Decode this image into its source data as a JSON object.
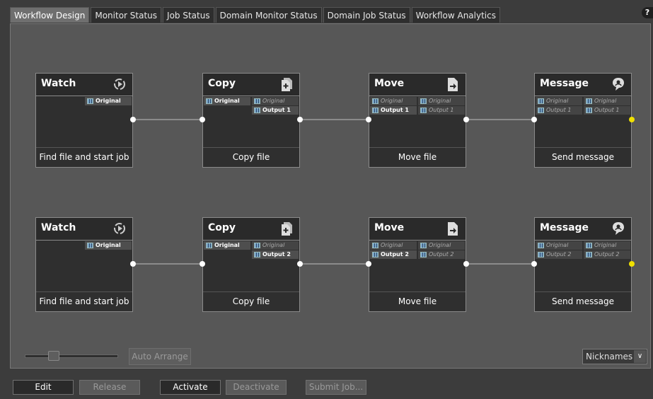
{
  "tabs": [
    {
      "label": "Workflow Design",
      "active": true
    },
    {
      "label": "Monitor Status"
    },
    {
      "label": "Job Status"
    },
    {
      "label": "Domain Monitor Status"
    },
    {
      "label": "Domain Job Status"
    },
    {
      "label": "Workflow Analytics"
    }
  ],
  "help_label": "?",
  "workflow_rows": [
    {
      "nodes": [
        {
          "title": "Watch",
          "icon": "watch-icon",
          "footer": "Find file and start job",
          "chips_left": [],
          "chips_right": [
            {
              "label": "Original",
              "dim": false
            }
          ]
        },
        {
          "title": "Copy",
          "icon": "copy-icon",
          "footer": "Copy file",
          "chips_left": [
            {
              "label": "Original",
              "dim": false
            }
          ],
          "chips_right": [
            {
              "label": "Original",
              "dim": true
            },
            {
              "label": "Output 1",
              "dim": false
            }
          ]
        },
        {
          "title": "Move",
          "icon": "move-icon",
          "footer": "Move file",
          "chips_left": [
            {
              "label": "Original",
              "dim": true
            },
            {
              "label": "Output 1",
              "dim": false
            }
          ],
          "chips_right": [
            {
              "label": "Original",
              "dim": true
            },
            {
              "label": "Output 1",
              "dim": true
            }
          ]
        },
        {
          "title": "Message",
          "icon": "message-icon",
          "footer": "Send message",
          "chips_left": [
            {
              "label": "Original",
              "dim": true
            },
            {
              "label": "Output 1",
              "dim": true
            }
          ],
          "chips_right": [
            {
              "label": "Original",
              "dim": true
            },
            {
              "label": "Output 1",
              "dim": true
            }
          ]
        }
      ]
    },
    {
      "nodes": [
        {
          "title": "Watch",
          "icon": "watch-icon",
          "footer": "Find file and start job",
          "chips_left": [],
          "chips_right": [
            {
              "label": "Original",
              "dim": false
            }
          ]
        },
        {
          "title": "Copy",
          "icon": "copy-icon",
          "footer": "Copy file",
          "chips_left": [
            {
              "label": "Original",
              "dim": false
            }
          ],
          "chips_right": [
            {
              "label": "Original",
              "dim": true
            },
            {
              "label": "Output 2",
              "dim": false
            }
          ]
        },
        {
          "title": "Move",
          "icon": "move-icon",
          "footer": "Move file",
          "chips_left": [
            {
              "label": "Original",
              "dim": true
            },
            {
              "label": "Output 2",
              "dim": false
            }
          ],
          "chips_right": [
            {
              "label": "Original",
              "dim": true
            },
            {
              "label": "Output 2",
              "dim": true
            }
          ]
        },
        {
          "title": "Message",
          "icon": "message-icon",
          "footer": "Send message",
          "chips_left": [
            {
              "label": "Original",
              "dim": true
            },
            {
              "label": "Output 2",
              "dim": true
            }
          ],
          "chips_right": [
            {
              "label": "Original",
              "dim": true
            },
            {
              "label": "Output 2",
              "dim": true
            }
          ]
        }
      ]
    }
  ],
  "canvas_footer": {
    "auto_arrange_label": "Auto Arrange",
    "nicknames_label": "Nicknames"
  },
  "buttons": {
    "edit": "Edit",
    "release": "Release",
    "activate": "Activate",
    "deactivate": "Deactivate",
    "submit_job": "Submit Job..."
  },
  "colors": {
    "active_port": "#f0e000",
    "canvas": "#575757",
    "node_bg": "#2f2f2f"
  }
}
